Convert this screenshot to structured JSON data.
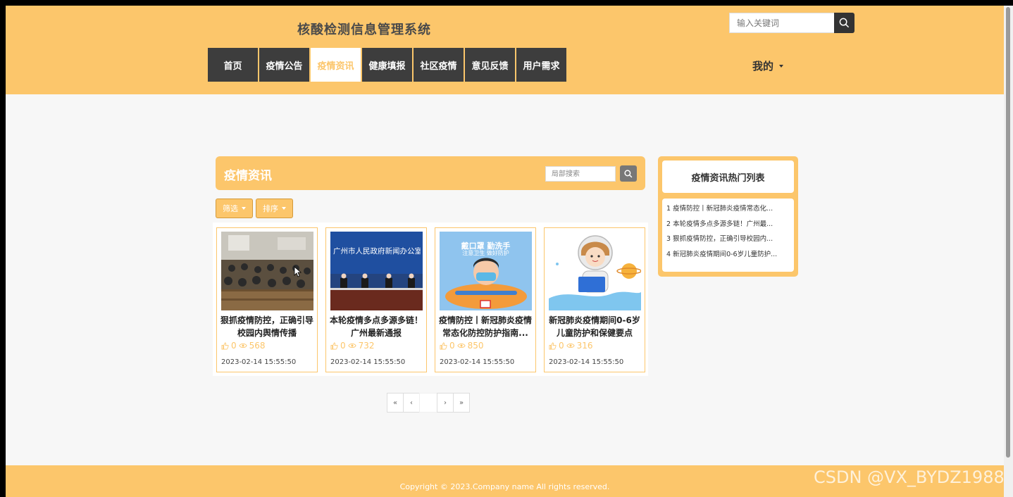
{
  "header": {
    "site_title": "核酸检测信息管理系统",
    "search_placeholder": "输入关键词",
    "nav": [
      "首页",
      "疫情公告",
      "疫情资讯",
      "健康填报",
      "社区疫情",
      "意见反馈",
      "用户需求"
    ],
    "active_nav": "疫情资讯",
    "me_label": "我的"
  },
  "main": {
    "section_title": "疫情资讯",
    "local_search_placeholder": "局部搜索",
    "filter_label": "筛选",
    "sort_label": "排序",
    "cards": [
      {
        "title": "狠抓疫情防控，正确引导校园内舆情传播",
        "likes": "0",
        "views": "568",
        "date": "2023-02-14 15:55:50"
      },
      {
        "title": "本轮疫情多点多源多链！广州最新通报",
        "likes": "0",
        "views": "732",
        "date": "2023-02-14 15:55:50"
      },
      {
        "title": "疫情防控丨新冠肺炎疫情常态化防控防护指南...",
        "likes": "0",
        "views": "850",
        "date": "2023-02-14 15:55:50"
      },
      {
        "title": "新冠肺炎疫情期间0-6岁儿童防护和保健要点",
        "likes": "0",
        "views": "316",
        "date": "2023-02-14 15:55:50"
      }
    ],
    "card2_banner": "广州市人民政府新闻办公室",
    "card3_banner1": "戴口罩 勤洗手",
    "card3_banner2": "注意卫生 做好防护",
    "pager": [
      "«",
      "‹",
      "›",
      "»"
    ]
  },
  "sidebar": {
    "title": "疫情资讯热门列表",
    "items": [
      "1  疫情防控丨新冠肺炎疫情常态化...",
      "2  本轮疫情多点多源多链！广州最...",
      "3  狠抓疫情防控，正确引导校园内...",
      "4  新冠肺炎疫情期间0-6岁儿童防护..."
    ]
  },
  "footer": {
    "copyright": "Copyright © 2023.Company name All rights reserved.",
    "watermark": "CSDN @VX_BYDZ1988"
  },
  "colors": {
    "accent": "#fcc66b",
    "nav_dark": "#3d3d3d",
    "page_bg": "#f7f7f7"
  }
}
